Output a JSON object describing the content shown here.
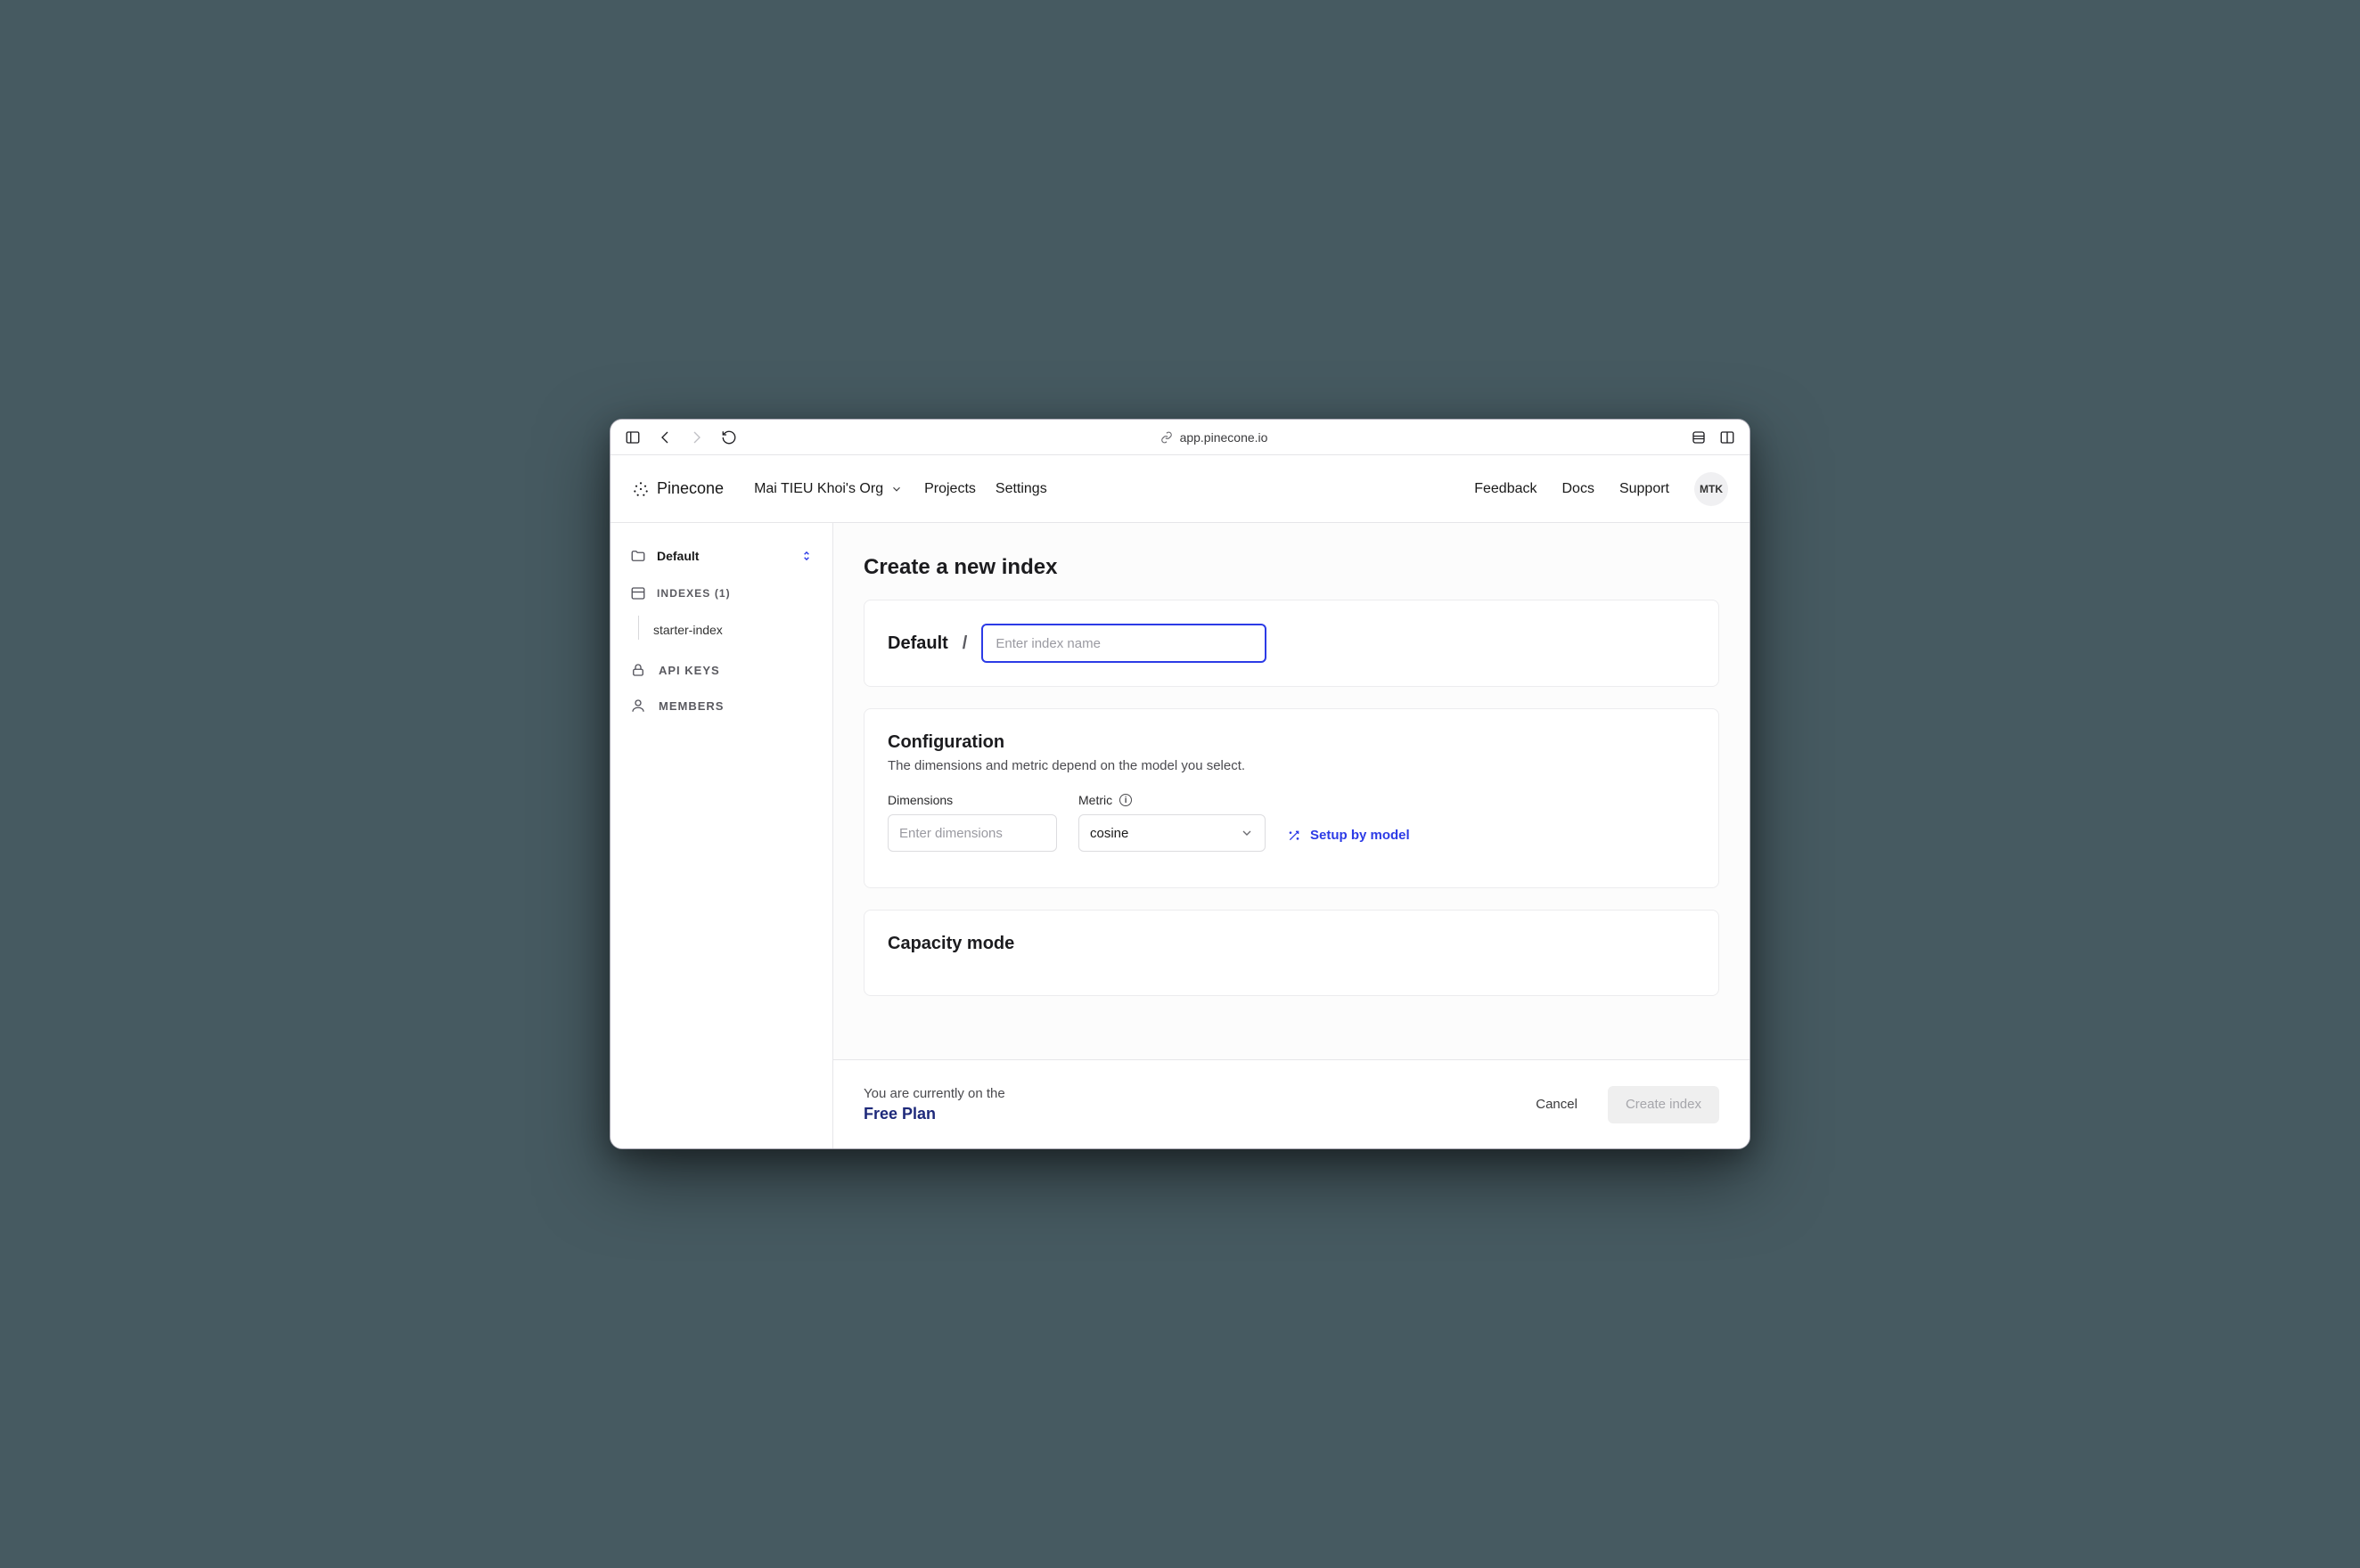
{
  "browser": {
    "url": "app.pinecone.io"
  },
  "header": {
    "brand": "Pinecone",
    "org": "Mai TIEU Khoi's Org",
    "nav": {
      "projects": "Projects",
      "settings": "Settings"
    },
    "right": {
      "feedback": "Feedback",
      "docs": "Docs",
      "support": "Support"
    },
    "avatar_initials": "MTK"
  },
  "sidebar": {
    "project_name": "Default",
    "indexes_label": "INDEXES (1)",
    "indexes": [
      {
        "name": "starter-index"
      }
    ],
    "api_keys": "API KEYS",
    "members": "MEMBERS"
  },
  "page": {
    "title": "Create a new index",
    "name_prefix": "Default",
    "name_placeholder": "Enter index name",
    "config": {
      "title": "Configuration",
      "subtitle": "The dimensions and metric depend on the model you select.",
      "dimensions_label": "Dimensions",
      "dimensions_placeholder": "Enter dimensions",
      "metric_label": "Metric",
      "metric_value": "cosine",
      "setup_link": "Setup by model"
    },
    "capacity": {
      "title": "Capacity mode"
    }
  },
  "footer": {
    "plan_note": "You are currently on the",
    "plan_name": "Free Plan",
    "cancel": "Cancel",
    "create": "Create index"
  }
}
